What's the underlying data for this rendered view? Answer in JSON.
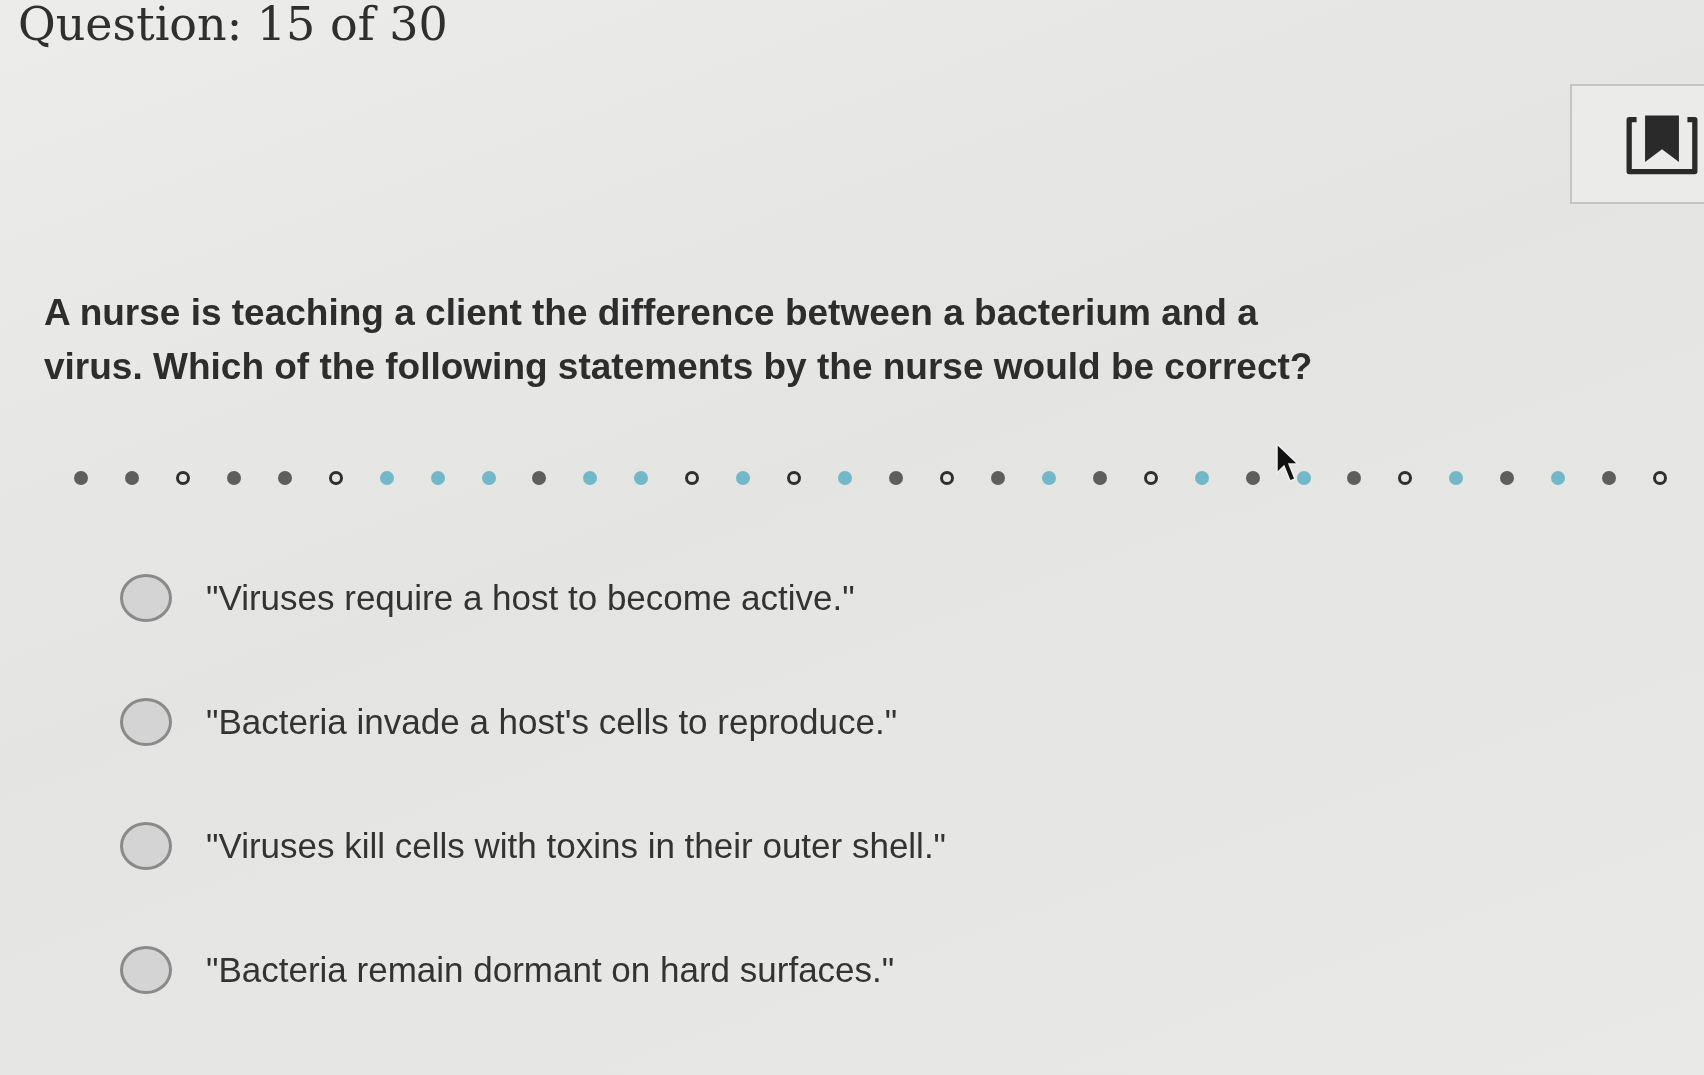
{
  "header": {
    "title": "Question: 15 of 30"
  },
  "question": {
    "text": "A nurse is teaching a client the difference between a bacterium and a virus. Which of the following statements by the nurse would be correct?"
  },
  "nav_dots": [
    {
      "kind": "filled",
      "color": "#5e5e5e"
    },
    {
      "kind": "filled",
      "color": "#5e5e5e"
    },
    {
      "kind": "ring",
      "color": "#2f2f2f"
    },
    {
      "kind": "filled",
      "color": "#5e5e5e"
    },
    {
      "kind": "filled",
      "color": "#5e5e5e"
    },
    {
      "kind": "ring",
      "color": "#2f2f2f"
    },
    {
      "kind": "filled",
      "color": "#72b8c8"
    },
    {
      "kind": "filled",
      "color": "#72b8c8"
    },
    {
      "kind": "filled",
      "color": "#72b8c8"
    },
    {
      "kind": "filled",
      "color": "#5e5e5e"
    },
    {
      "kind": "filled",
      "color": "#72b8c8"
    },
    {
      "kind": "filled",
      "color": "#72b8c8"
    },
    {
      "kind": "ring",
      "color": "#2f2f2f"
    },
    {
      "kind": "filled",
      "color": "#72b8c8"
    },
    {
      "kind": "ring",
      "color": "#2f2f2f"
    },
    {
      "kind": "filled",
      "color": "#72b8c8"
    },
    {
      "kind": "filled",
      "color": "#5e5e5e"
    },
    {
      "kind": "ring",
      "color": "#2f2f2f"
    },
    {
      "kind": "filled",
      "color": "#5e5e5e"
    },
    {
      "kind": "filled",
      "color": "#72b8c8"
    },
    {
      "kind": "filled",
      "color": "#5e5e5e"
    },
    {
      "kind": "ring",
      "color": "#2f2f2f"
    },
    {
      "kind": "filled",
      "color": "#72b8c8"
    },
    {
      "kind": "filled",
      "color": "#5e5e5e"
    },
    {
      "kind": "filled",
      "color": "#72b8c8"
    },
    {
      "kind": "filled",
      "color": "#5e5e5e"
    },
    {
      "kind": "ring",
      "color": "#2f2f2f"
    },
    {
      "kind": "filled",
      "color": "#72b8c8"
    },
    {
      "kind": "filled",
      "color": "#5e5e5e"
    },
    {
      "kind": "filled",
      "color": "#72b8c8"
    },
    {
      "kind": "filled",
      "color": "#5e5e5e"
    },
    {
      "kind": "ring",
      "color": "#2f2f2f"
    }
  ],
  "options": [
    {
      "text": "\"Viruses require a host to become active.\"",
      "selected": false
    },
    {
      "text": "\"Bacteria invade a host's cells to reproduce.\"",
      "selected": false
    },
    {
      "text": "\"Viruses kill cells with toxins in their outer shell.\"",
      "selected": false
    },
    {
      "text": "\"Bacteria remain dormant on hard surfaces.\"",
      "selected": false
    }
  ]
}
